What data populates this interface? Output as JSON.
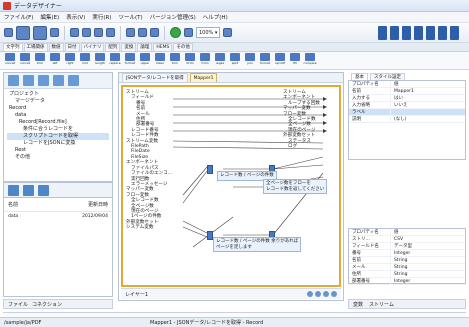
{
  "app": {
    "title": "データデザイナー"
  },
  "menu": [
    "ファイル(F)",
    "編集(E)",
    "表示(V)",
    "実行(R)",
    "ツール(T)",
    "バージョン管理(S)",
    "ヘルプ(H)"
  ],
  "toolbar": {
    "zoom_value": "100%"
  },
  "ribbon_tabs": [
    "文字列",
    "工場関係",
    "数値",
    "日付",
    "バイナリ",
    "配列",
    "変換",
    "論理",
    "HEMS",
    "その他"
  ],
  "ribbon_tools": [
    "concat",
    "concat",
    "trim",
    "left",
    "right",
    "mid",
    "length",
    "replace",
    "format",
    "upper",
    "lower",
    "trim",
    "ltrim",
    "rtrim",
    "regex",
    "split",
    "join",
    "format",
    "sprintf",
    "fill",
    "compare"
  ],
  "project_tree": {
    "items": [
      "プロジェクト",
      "マージデータ",
      "Record",
      "data",
      "Record[Record.file]",
      "条件に合うレコードを",
      "スクリプトコードを取得",
      "レコードをJSONに変換",
      "Rest",
      "その他"
    ]
  },
  "file_list": {
    "headers": {
      "name": "名前",
      "date": "更新日時"
    },
    "rows": [
      {
        "name": "data",
        "date": "2012/09/04"
      }
    ]
  },
  "left_tabs": [
    "ファイル",
    "コネクション"
  ],
  "editor": {
    "tabs": [
      "JSONデータ/レコードを取得",
      "Mapper1"
    ],
    "left_tree": [
      {
        "level": 0,
        "text": "ストリーム"
      },
      {
        "level": 1,
        "text": "フィールド"
      },
      {
        "level": 2,
        "text": "番号"
      },
      {
        "level": 2,
        "text": "名前"
      },
      {
        "level": 2,
        "text": "メール"
      },
      {
        "level": 2,
        "text": "住所"
      },
      {
        "level": 2,
        "text": "部署番号"
      },
      {
        "level": 1,
        "text": "レコード番号"
      },
      {
        "level": 1,
        "text": "レコード件数"
      },
      {
        "level": 0,
        "text": "ストリーム変数"
      },
      {
        "level": 1,
        "text": "FilePath"
      },
      {
        "level": 1,
        "text": "FileDate"
      },
      {
        "level": 1,
        "text": "FileSize"
      },
      {
        "level": 0,
        "text": "エンボーネント"
      },
      {
        "level": 1,
        "text": "ファイルパス"
      },
      {
        "level": 1,
        "text": "ファイルのエンコ..."
      },
      {
        "level": 1,
        "text": "実行回数"
      },
      {
        "level": 1,
        "text": "エラーメッセージ"
      },
      {
        "level": 0,
        "text": "マッパー変数"
      },
      {
        "level": 0,
        "text": "フロー変数"
      },
      {
        "level": 1,
        "text": "全レコード数"
      },
      {
        "level": 1,
        "text": "全ページ数"
      },
      {
        "level": 1,
        "text": "現在のページ"
      },
      {
        "level": 1,
        "text": "1ページの件数"
      },
      {
        "level": 0,
        "text": "外部変数セット"
      },
      {
        "level": 0,
        "text": "システム変数"
      }
    ],
    "right_tree": [
      {
        "level": 0,
        "text": "ストリーム"
      },
      {
        "level": 0,
        "text": "エンボーネント"
      },
      {
        "level": 1,
        "text": "ループする回数"
      },
      {
        "level": 0,
        "text": "マッパー変数"
      },
      {
        "level": 0,
        "text": "フロー変数"
      },
      {
        "level": 1,
        "text": "全レコード数"
      },
      {
        "level": 1,
        "text": "全ページ数"
      },
      {
        "level": 1,
        "text": "現在のページ"
      },
      {
        "level": 0,
        "text": "外部変数セット"
      },
      {
        "level": 1,
        "text": "ステータス"
      },
      {
        "level": 1,
        "text": "ログ"
      }
    ],
    "nodes": {
      "n1": "レコード数 / ページの件数",
      "n2": "全ページ数をフローを\nレコード数を返してください",
      "n3": "レコード数 / ページの件数 余りがあれば\nページを足します"
    },
    "status_label": "レイヤー1"
  },
  "properties": {
    "tabs": [
      "基本",
      "スタイル設定"
    ],
    "rows": [
      {
        "k": "プロパティ名",
        "v": "値"
      },
      {
        "k": "名前",
        "v": "Mapper1"
      },
      {
        "k": "入力する",
        "v": "はい"
      },
      {
        "k": "入力省略",
        "v": "いいえ"
      },
      {
        "k": "ラベル",
        "v": ""
      },
      {
        "k": "説明",
        "v": "(なし)"
      }
    ]
  },
  "properties2": {
    "rows": [
      {
        "k": "プロパティ名",
        "v": "値"
      },
      {
        "k": "ストリ...",
        "v": "CSV"
      },
      {
        "k": "フィールド名",
        "v": "データ型"
      },
      {
        "k": "番号",
        "v": "Integer"
      },
      {
        "k": "名前",
        "v": "String"
      },
      {
        "k": "メール",
        "v": "String"
      },
      {
        "k": "住所",
        "v": "String"
      },
      {
        "k": "部署番号",
        "v": "Integer"
      }
    ]
  },
  "right_bottom_tabs": [
    "変数",
    "ストリーム"
  ],
  "statusbar": {
    "path": "/sample/ja/PDF",
    "context": "Mapper1 - JSONデータ/レコードを取得 - Record"
  }
}
